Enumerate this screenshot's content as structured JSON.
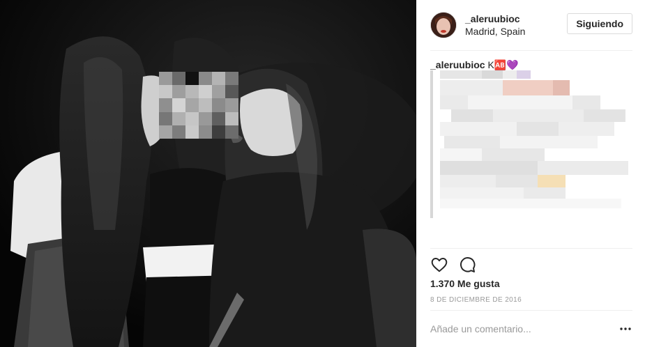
{
  "post": {
    "username": "_aleruubioc",
    "location": "Madrid, Spain",
    "follow_label": "Siguiendo",
    "caption": {
      "username": "_aleruubioc",
      "text": "K🆎",
      "emoji": "💜"
    },
    "actions": {
      "like_icon": "heart-outline-icon",
      "comment_icon": "speech-bubble-icon"
    },
    "likes": "1.370 Me gusta",
    "date": "8 DE DICIEMBRE DE 2016",
    "comment": {
      "placeholder": "Añade un comentario...",
      "more_icon": "more-options-icon"
    }
  },
  "colors": {
    "text": "#262626",
    "muted": "#999999",
    "border": "#dbdbdb",
    "divider": "#efefef",
    "photo_bg": "#0b0b0b"
  }
}
